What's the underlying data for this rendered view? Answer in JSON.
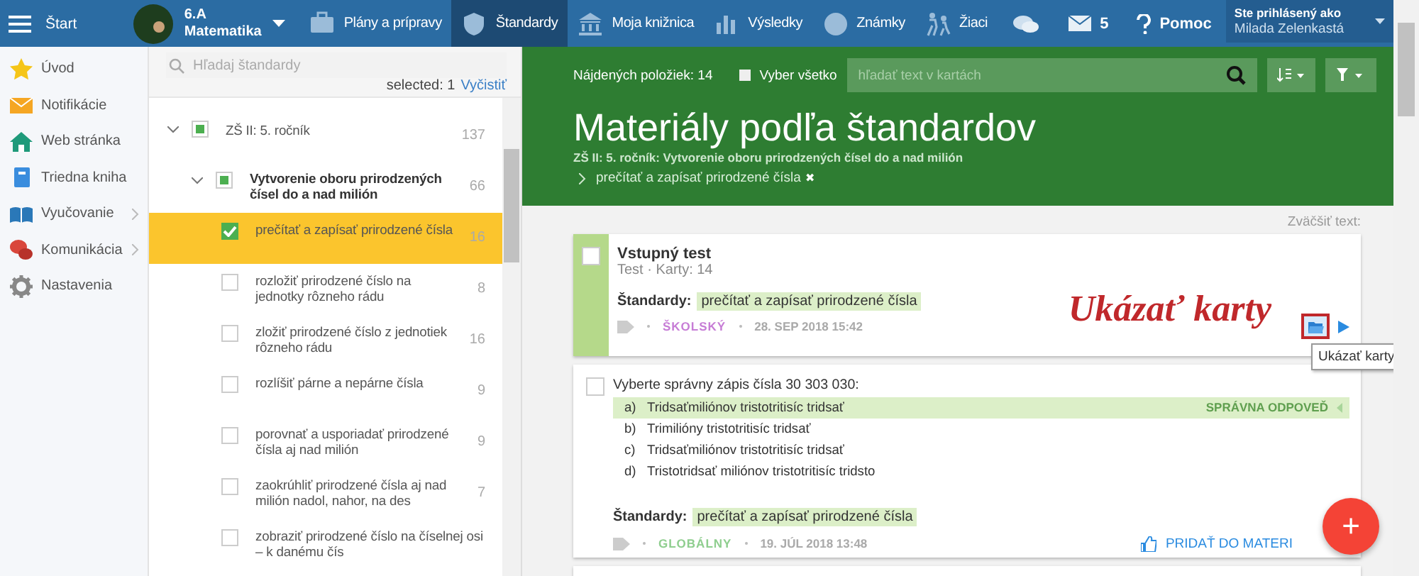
{
  "topbar": {
    "menu_label": "Štart",
    "class_name": "6.A",
    "class_subject": "Matematika",
    "nav": [
      {
        "label": "Plány a prípravy",
        "selected": false
      },
      {
        "label": "Štandardy",
        "selected": true
      },
      {
        "label": "Moja knižnica",
        "selected": false
      },
      {
        "label": "Výsledky",
        "selected": false
      },
      {
        "label": "Známky",
        "selected": false
      },
      {
        "label": "Žiaci",
        "selected": false
      }
    ],
    "mail_count": "5",
    "help": "Pomoc",
    "user_caption": "Ste prihlásený ako",
    "user_name": "Milada Zelenkastá"
  },
  "sidebar": {
    "items": [
      {
        "label": "Úvod",
        "expandable": false
      },
      {
        "label": "Notifikácie",
        "expandable": false
      },
      {
        "label": "Web stránka",
        "expandable": false
      },
      {
        "label": "Triedna kniha",
        "expandable": false
      },
      {
        "label": "Vyučovanie",
        "expandable": true
      },
      {
        "label": "Komunikácia",
        "expandable": true
      },
      {
        "label": "Nastavenia",
        "expandable": false
      }
    ]
  },
  "tree": {
    "search_placeholder": "Hľadaj štandardy",
    "selected_count": "selected: 1",
    "clear": "Vyčistiť",
    "nodes": [
      {
        "label": "ZŠ II: 5. ročník",
        "count": "137",
        "checked": false,
        "partial": true,
        "expanded": true,
        "selected": false,
        "children": [
          {
            "label": "Vytvorenie oboru prirodzených čísel do a nad milión",
            "count": "66",
            "checked": false,
            "partial": true,
            "expanded": true,
            "selected": false,
            "children": [
              {
                "label": "prečítať a zapísať prirodzené čísla",
                "count": "16",
                "checked": true,
                "selected": true
              },
              {
                "label": "rozložiť prirodzené číslo na jednotky rôzneho rádu",
                "count": "8",
                "checked": false,
                "selected": false
              },
              {
                "label": "zložiť prirodzené číslo z jednotiek rôzneho rádu",
                "count": "16",
                "checked": false,
                "selected": false
              },
              {
                "label": "rozlíšiť párne a nepárne čísla",
                "count": "9",
                "checked": false,
                "selected": false
              },
              {
                "label": "porovnať a usporiadať prirodzené čísla aj nad milión",
                "count": "9",
                "checked": false,
                "selected": false
              },
              {
                "label": "zaokrúhliť prirodzené čísla aj nad milión nadol, nahor, na des",
                "count": "7",
                "checked": false,
                "selected": false
              },
              {
                "label": "zobraziť prirodzené číslo na číselnej osi – k danému čís",
                "checked": false,
                "selected": false
              }
            ]
          }
        ]
      }
    ]
  },
  "header": {
    "found": "Nájdených položiek: 14",
    "select_all": {
      "label": "Vyber všetko",
      "checked": false
    },
    "search_placeholder": "hľadať text v kartách",
    "title": "Materiály podľa štandardov",
    "path": "ZŠ II: 5. ročník: Vytvorenie oboru prirodzených čísel do a nad milión",
    "chip": "prečítať a zapísať prirodzené čísla",
    "chip_remove": "✖"
  },
  "zoom_text": "Zväčšiť text:",
  "cards": [
    {
      "kind": "test",
      "checked": false,
      "title": "Vstupný test",
      "meta": "Test · Karty: 14",
      "standards_label": "Štandardy:",
      "standard": "prečítať a zapísať prirodzené čísla",
      "scope": "ŠKOLSKÝ",
      "color": "#c77dd6",
      "date": "28. SEP 2018 15:42"
    },
    {
      "kind": "question",
      "checked": false,
      "question": "Vyberte správny zápis čísla 30 303 030:",
      "correct_label": "SPRÁVNA ODPOVEĎ",
      "answers": [
        {
          "letter": "a)",
          "text": "Tridsaťmiliónov tristotritisíc tridsať",
          "correct": true
        },
        {
          "letter": "b)",
          "text": "Trimilióny tristotritisíc tridsať",
          "correct": false
        },
        {
          "letter": "c)",
          "text": "Tridsaťmiliónov tristotritisíc tridsať",
          "correct": false
        },
        {
          "letter": "d)",
          "text": "Tristotridsať miliónov tristotritisíc tridsto",
          "correct": false
        }
      ],
      "standards_label": "Štandardy:",
      "standard": "prečítať a zapísať prirodzené čísla",
      "scope": "GLOBÁLNY",
      "color": "#8fce8f",
      "date": "19. JÚL 2018 13:48",
      "action": "PRIDAŤ DO MATERI"
    },
    {
      "kind": "stub"
    }
  ],
  "annotation": "Ukázať karty",
  "tooltip": "Ukázať karty",
  "fab": "+"
}
